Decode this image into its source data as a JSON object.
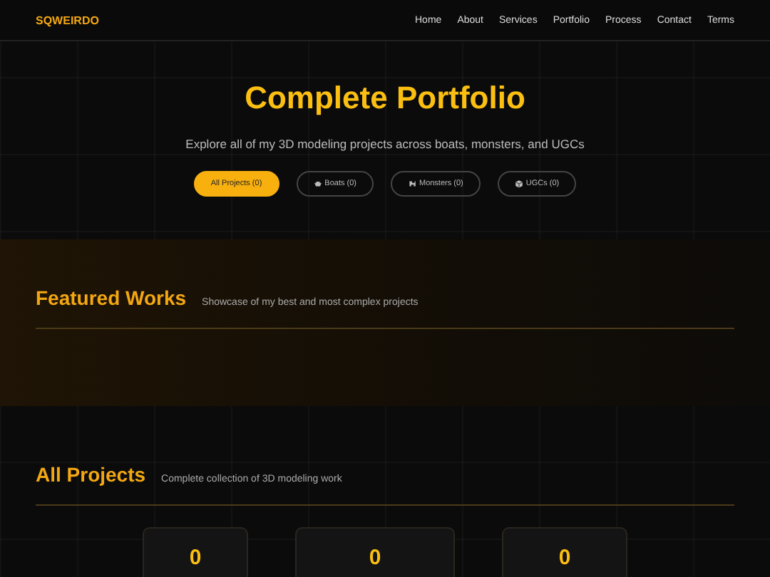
{
  "nav": {
    "logo": "SQWEIRDO",
    "links": [
      "Home",
      "About",
      "Services",
      "Portfolio",
      "Process",
      "Contact",
      "Terms"
    ]
  },
  "hero": {
    "title": "Complete Portfolio",
    "subtitle": "Explore all of my 3D modeling projects across boats, monsters, and UGCs",
    "filters": [
      {
        "kind": "all",
        "label": "All Projects (0)",
        "selected": true
      },
      {
        "kind": "boats",
        "label": "Boats (0)",
        "selected": false
      },
      {
        "kind": "monsters",
        "label": "Monsters (0)",
        "selected": false
      },
      {
        "kind": "ugcs",
        "label": "UGCs (0)",
        "selected": false
      }
    ]
  },
  "featured": {
    "title": "Featured Works",
    "subtitle": "Showcase of my best and most complex projects"
  },
  "all_projects": {
    "title": "All Projects",
    "subtitle": "Complete collection of 3D modeling work",
    "stats": [
      "0",
      "0",
      "0"
    ]
  }
}
